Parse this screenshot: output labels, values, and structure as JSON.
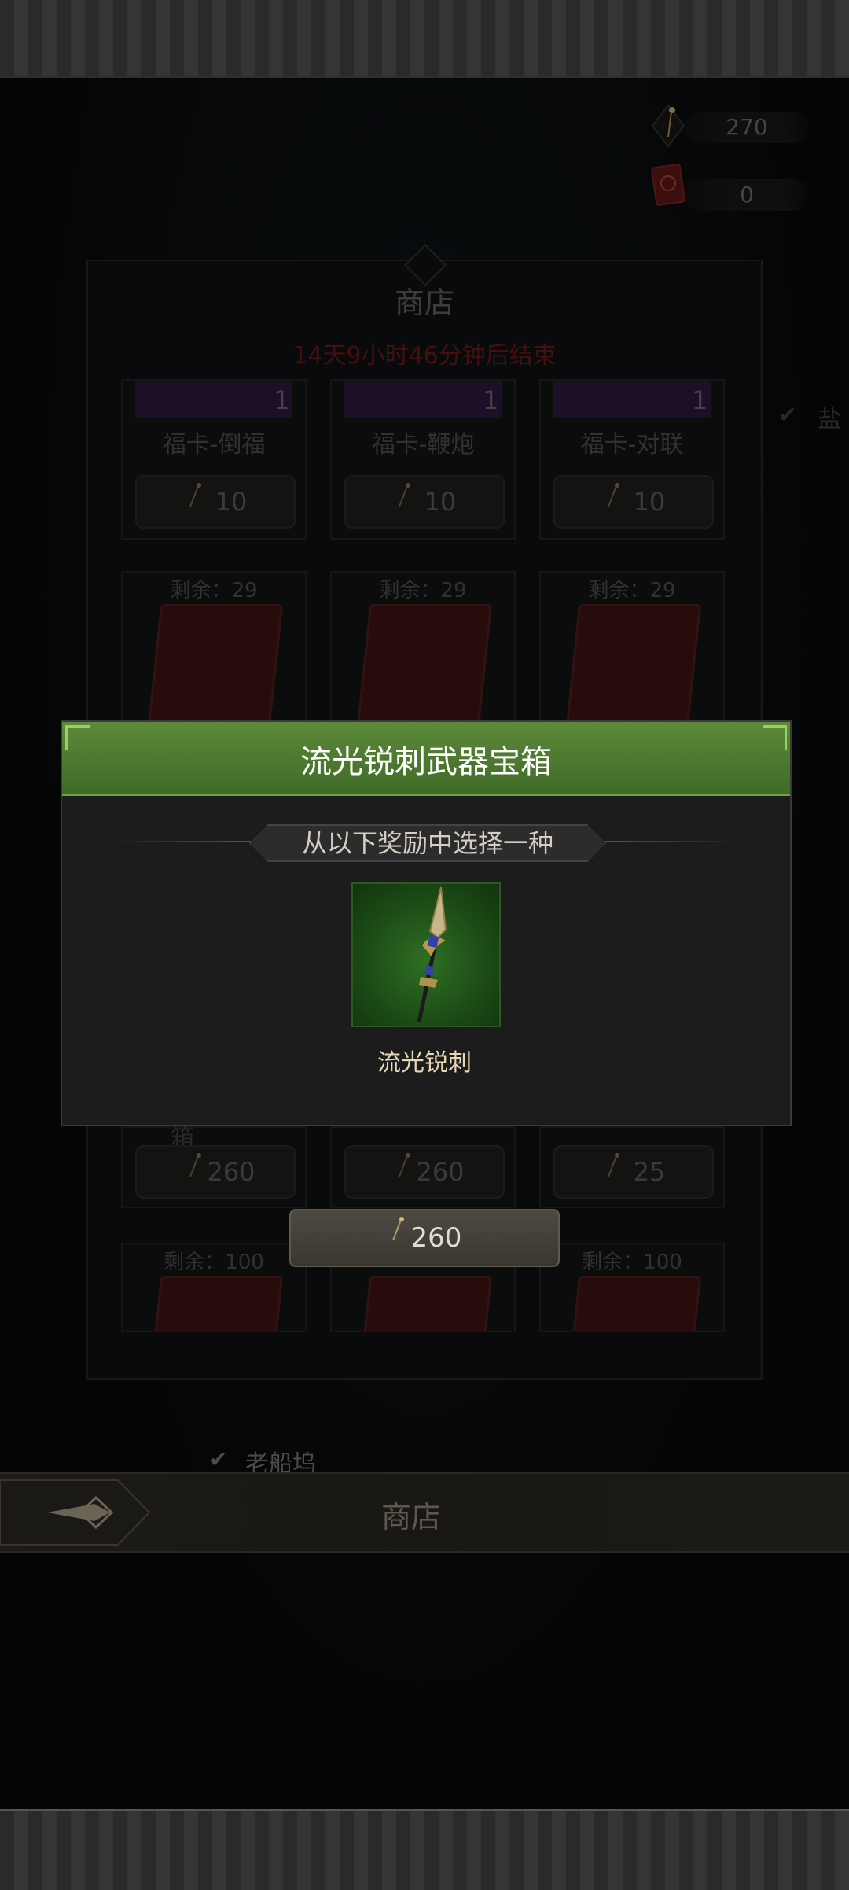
{
  "currency": {
    "spark_amount": "270",
    "redcard_amount": "0"
  },
  "shop": {
    "title": "商店",
    "timer": "14天9小时46分钟后结束",
    "row1": [
      {
        "name": "福卡-倒福",
        "qty": "1",
        "price": "10"
      },
      {
        "name": "福卡-鞭炮",
        "qty": "1",
        "price": "10"
      },
      {
        "name": "福卡-对联",
        "qty": "1",
        "price": "10"
      }
    ],
    "row2": [
      {
        "remain": "剩余：29"
      },
      {
        "remain": "剩余：29"
      },
      {
        "remain": "剩余：29"
      }
    ],
    "row3_partial_text": "箱",
    "row3": [
      {
        "price": "260"
      },
      {
        "price": "260"
      },
      {
        "price": "25"
      }
    ],
    "row4": [
      {
        "remain": "剩余：100"
      },
      {
        "remain": "剩余：100"
      }
    ],
    "side_label_1": "盐",
    "side_label_2": "老船坞"
  },
  "modal": {
    "title": "流光锐刺武器宝箱",
    "subtitle": "从以下奖励中选择一种",
    "reward_name": "流光锐刺",
    "buy_price": "260"
  },
  "nav": {
    "title": "商店"
  }
}
